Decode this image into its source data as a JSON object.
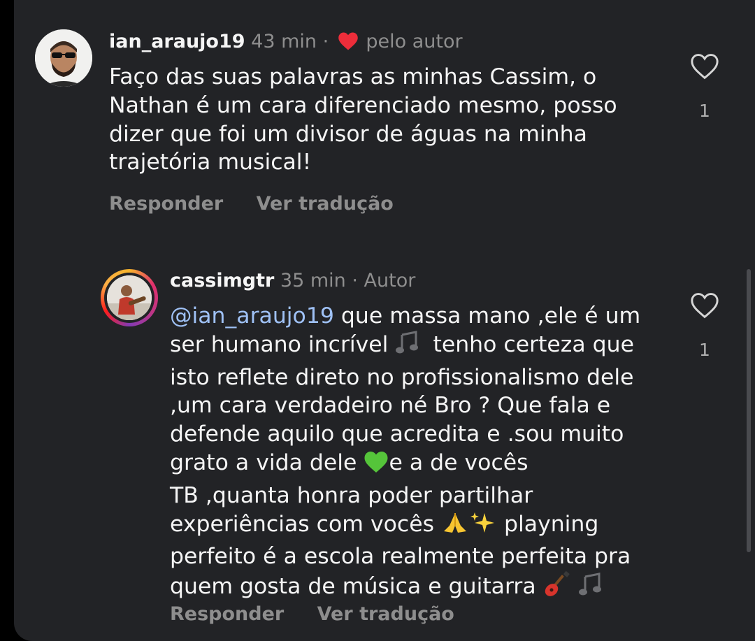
{
  "comments": [
    {
      "username": "ian_araujo19",
      "time": "43 min",
      "separator": "·",
      "badge": "pelo autor",
      "text_lines": [
        "Faço das suas palavras as minhas Cassim, o",
        "Nathan é um cara diferenciado mesmo, posso",
        "dizer que foi um divisor de águas na minha",
        "trajetória musical!"
      ],
      "like_count": "1",
      "reply_label": "Responder",
      "translate_label": "Ver tradução"
    },
    {
      "username": "cassimgtr",
      "time": "35 min",
      "separator": "·",
      "badge": "Autor",
      "mention": "@ian_araujo19",
      "text_lines": [
        " que massa mano ,ele é um",
        "ser humano incrível",
        " tenho certeza que",
        "isto reflete direto no profissionalismo dele",
        ",um cara verdadeiro né Bro ? Que fala e",
        "defende aquilo que acredita e .sou muito",
        "grato a vida dele",
        "e a de vocês",
        "TB ,quanta honra poder partilhar",
        "experiências com vocês",
        " playning",
        "perfeito é a escola realmente perfeita pra",
        "quem gosta de música e guitarra"
      ],
      "like_count": "1",
      "reply_label": "Responder",
      "translate_label": "Ver tradução"
    }
  ],
  "icons": {
    "liked_by_author": "red-heart-icon",
    "like": "heart-outline-icon",
    "notes": "musical-notes-emoji",
    "green_heart": "green-heart-emoji",
    "pray": "folded-hands-emoji",
    "sparkles": "sparkles-emoji",
    "guitar": "guitar-emoji"
  },
  "colors": {
    "background": "#222326",
    "text": "#f5f5f5",
    "muted": "#8e8e8e",
    "mention": "#9fc1f5",
    "heart_red": "#ed2d3a"
  }
}
